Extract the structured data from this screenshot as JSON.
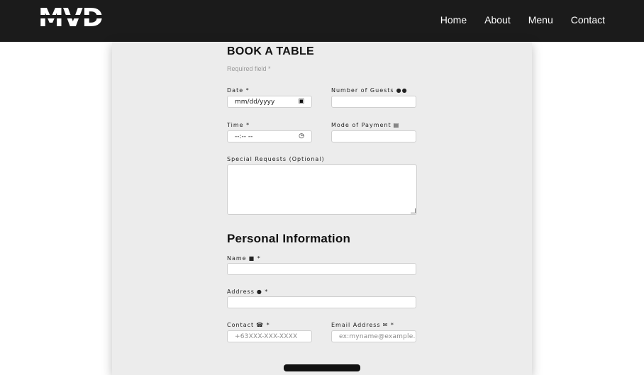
{
  "header": {
    "logo": "MVD",
    "nav": [
      "Home",
      "About",
      "Menu",
      "Contact"
    ]
  },
  "form": {
    "title": "BOOK A TABLE",
    "required_note": "Required field *",
    "date": {
      "label": "Date *",
      "value": "mm/dd/yyyy",
      "icon": "calendar-icon"
    },
    "guests": {
      "label": "Number of Guests",
      "icon": "users-icon",
      "value": ""
    },
    "time": {
      "label": "Time *",
      "value": "--:-- --",
      "icon": "clock-icon"
    },
    "payment": {
      "label": "Mode of Payment",
      "icon": "credit-card-icon",
      "value": ""
    },
    "special": {
      "label": "Special Requests (Optional)",
      "value": ""
    },
    "personal_title": "Personal Information",
    "name": {
      "label": "Name",
      "icon": "user-icon",
      "required": "*",
      "value": ""
    },
    "address": {
      "label": "Address",
      "icon": "map-marker-icon",
      "required": "*",
      "value": ""
    },
    "contact": {
      "label": "Contact",
      "icon": "phone-icon",
      "required": "*",
      "placeholder": "+63XXX-XXX-XXXX"
    },
    "email": {
      "label": "Email Address",
      "icon": "envelope-icon",
      "required": "*",
      "placeholder": "ex:myname@example.com"
    }
  },
  "colors": {
    "nav_bg": "#1b1b1b",
    "card_bg": "#ececec",
    "page_bg": "#ffffff"
  }
}
